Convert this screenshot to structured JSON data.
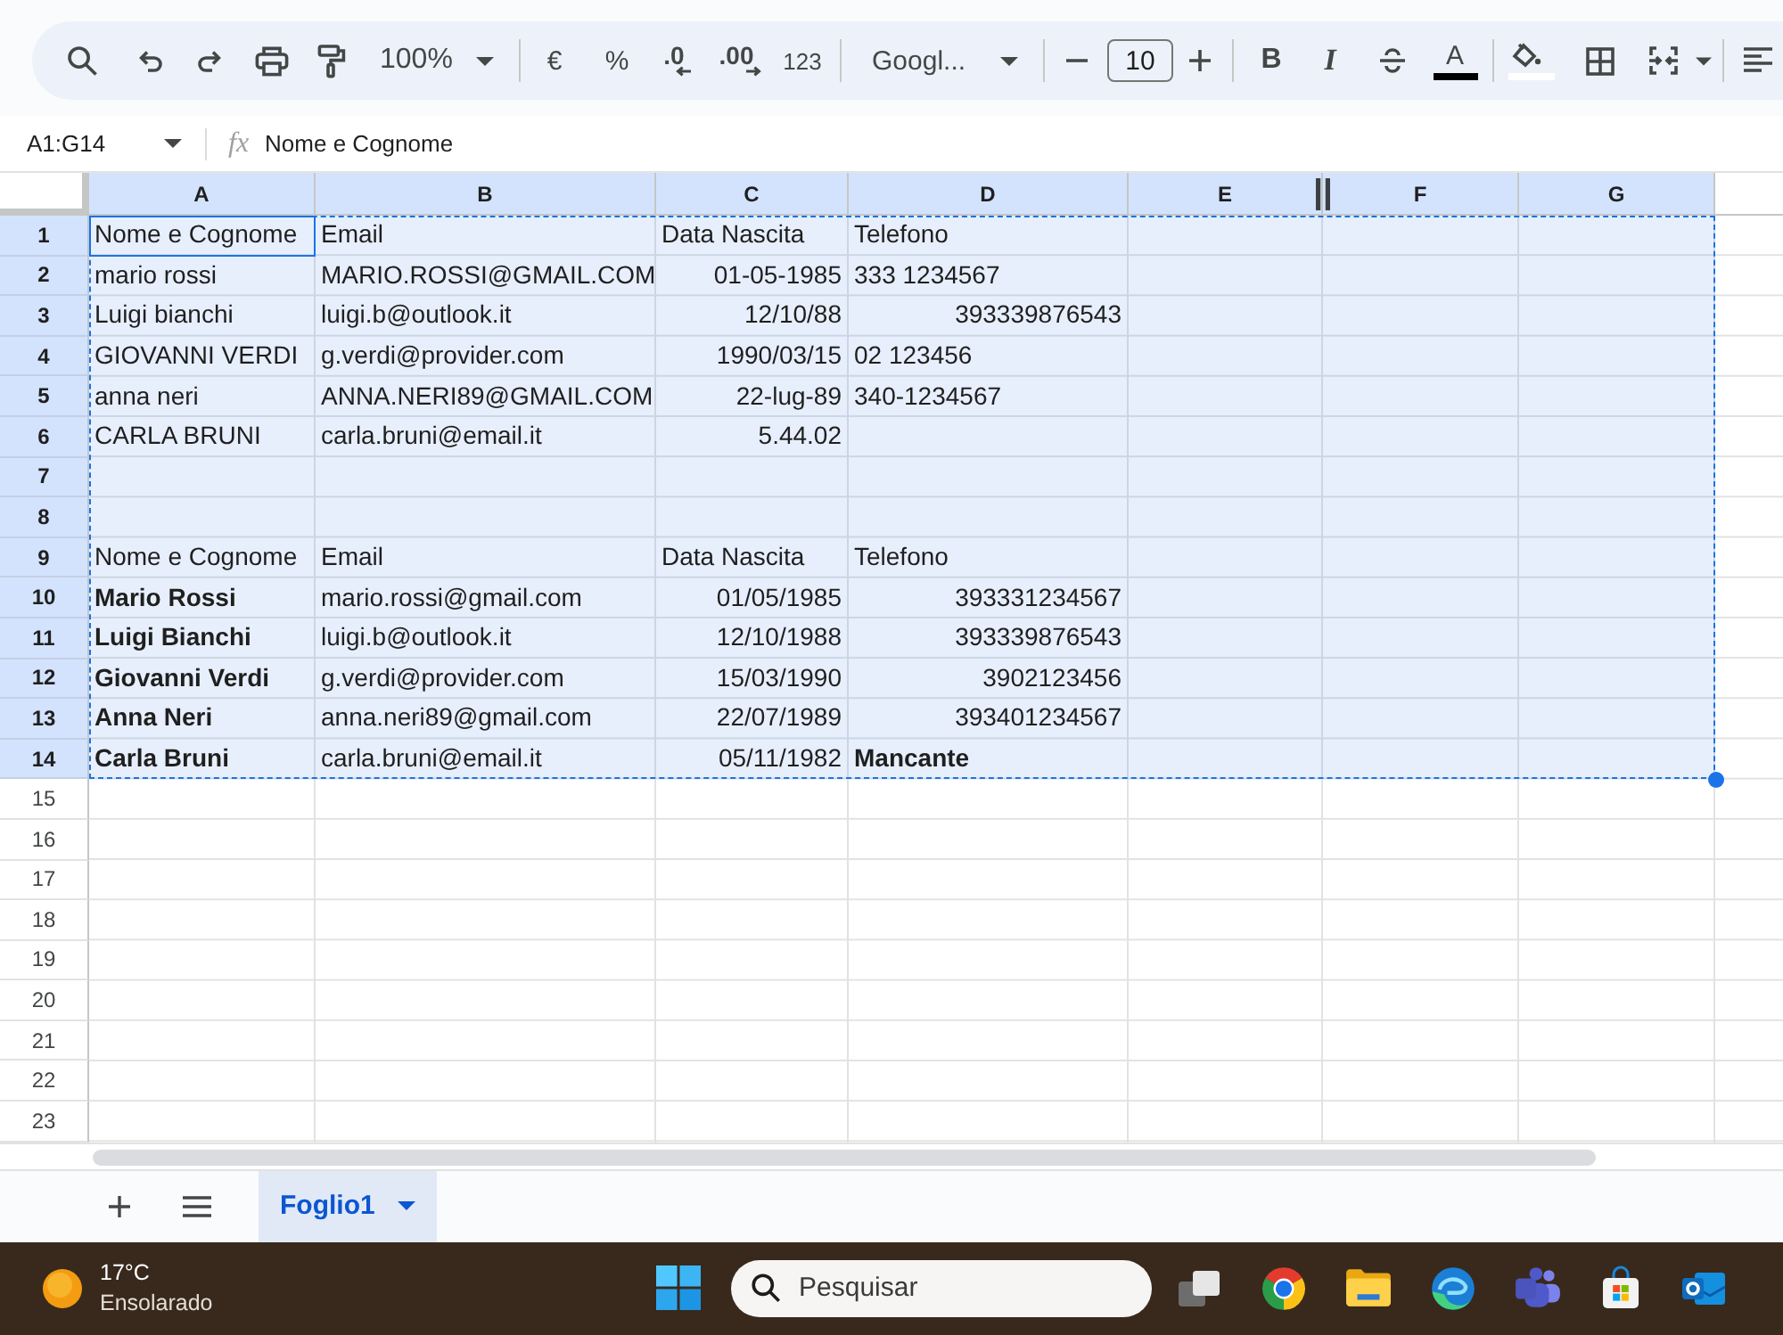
{
  "toolbar": {
    "zoom": "100%",
    "currency": "€",
    "percent": "%",
    "decrease_decimals": ".0",
    "increase_decimals": ".00",
    "number_format": "123",
    "font": "Googl...",
    "font_size": "10",
    "bold": "B",
    "italic": "I",
    "text_color": "A"
  },
  "formula_bar": {
    "name_box": "A1:G14",
    "function_label": "fx",
    "content": "Nome e Cognome"
  },
  "grid": {
    "selection_marquee": true,
    "columns": [
      {
        "label": "A",
        "selected": true
      },
      {
        "label": "B",
        "selected": true
      },
      {
        "label": "C",
        "selected": true
      },
      {
        "label": "D",
        "selected": true
      },
      {
        "label": "E",
        "selected": true
      },
      {
        "label": "F",
        "selected": true
      },
      {
        "label": "G",
        "selected": true
      }
    ],
    "rows": [
      {
        "label": "1",
        "selected": true,
        "cells": [
          {
            "text": "Nome e Cognome",
            "right_aligned": false,
            "bold": false,
            "active": true
          },
          {
            "text": "Email",
            "right_aligned": false,
            "bold": false,
            "active": false
          },
          {
            "text": "Data Nascita",
            "right_aligned": false,
            "bold": false,
            "active": false
          },
          {
            "text": "Telefono",
            "right_aligned": false,
            "bold": false,
            "active": false
          }
        ]
      },
      {
        "label": "2",
        "selected": true,
        "cells": [
          {
            "text": "mario rossi",
            "right_aligned": false,
            "bold": false,
            "active": false
          },
          {
            "text": "MARIO.ROSSI@GMAIL.COM",
            "right_aligned": false,
            "bold": false,
            "active": false
          },
          {
            "text": "01-05-1985",
            "right_aligned": true,
            "bold": false,
            "active": false
          },
          {
            "text": "333 1234567",
            "right_aligned": false,
            "bold": false,
            "active": false
          }
        ]
      },
      {
        "label": "3",
        "selected": true,
        "cells": [
          {
            "text": "Luigi bianchi",
            "right_aligned": false,
            "bold": false,
            "active": false
          },
          {
            "text": "luigi.b@outlook.it",
            "right_aligned": false,
            "bold": false,
            "active": false
          },
          {
            "text": "12/10/88",
            "right_aligned": true,
            "bold": false,
            "active": false
          },
          {
            "text": "393339876543",
            "right_aligned": true,
            "bold": false,
            "active": false
          }
        ]
      },
      {
        "label": "4",
        "selected": true,
        "cells": [
          {
            "text": "GIOVANNI VERDI",
            "right_aligned": false,
            "bold": false,
            "active": false
          },
          {
            "text": "g.verdi@provider.com",
            "right_aligned": false,
            "bold": false,
            "active": false
          },
          {
            "text": "1990/03/15",
            "right_aligned": true,
            "bold": false,
            "active": false
          },
          {
            "text": "02 123456",
            "right_aligned": false,
            "bold": false,
            "active": false
          }
        ]
      },
      {
        "label": "5",
        "selected": true,
        "cells": [
          {
            "text": "anna neri",
            "right_aligned": false,
            "bold": false,
            "active": false
          },
          {
            "text": "ANNA.NERI89@GMAIL.COM",
            "right_aligned": false,
            "bold": false,
            "active": false
          },
          {
            "text": "22-lug-89",
            "right_aligned": true,
            "bold": false,
            "active": false
          },
          {
            "text": "340-1234567",
            "right_aligned": false,
            "bold": false,
            "active": false
          }
        ]
      },
      {
        "label": "6",
        "selected": true,
        "cells": [
          {
            "text": "CARLA BRUNI",
            "right_aligned": false,
            "bold": false,
            "active": false
          },
          {
            "text": "carla.bruni@email.it",
            "right_aligned": false,
            "bold": false,
            "active": false
          },
          {
            "text": "5.44.02",
            "right_aligned": true,
            "bold": false,
            "active": false
          }
        ]
      },
      {
        "label": "7",
        "selected": true
      },
      {
        "label": "8",
        "selected": true
      },
      {
        "label": "9",
        "selected": true,
        "cells": [
          {
            "text": "Nome e Cognome",
            "right_aligned": false,
            "bold": false,
            "active": false
          },
          {
            "text": "Email",
            "right_aligned": false,
            "bold": false,
            "active": false
          },
          {
            "text": "Data Nascita",
            "right_aligned": false,
            "bold": false,
            "active": false
          },
          {
            "text": "Telefono",
            "right_aligned": false,
            "bold": false,
            "active": false
          }
        ]
      },
      {
        "label": "10",
        "selected": true,
        "cells": [
          {
            "text": "Mario Rossi",
            "right_aligned": false,
            "bold": true,
            "active": false
          },
          {
            "text": "mario.rossi@gmail.com",
            "right_aligned": false,
            "bold": false,
            "active": false
          },
          {
            "text": "01/05/1985",
            "right_aligned": true,
            "bold": false,
            "active": false
          },
          {
            "text": "393331234567",
            "right_aligned": true,
            "bold": false,
            "active": false
          }
        ]
      },
      {
        "label": "11",
        "selected": true,
        "cells": [
          {
            "text": "Luigi Bianchi",
            "right_aligned": false,
            "bold": true,
            "active": false
          },
          {
            "text": "luigi.b@outlook.it",
            "right_aligned": false,
            "bold": false,
            "active": false
          },
          {
            "text": "12/10/1988",
            "right_aligned": true,
            "bold": false,
            "active": false
          },
          {
            "text": "393339876543",
            "right_aligned": true,
            "bold": false,
            "active": false
          }
        ]
      },
      {
        "label": "12",
        "selected": true,
        "cells": [
          {
            "text": "Giovanni Verdi",
            "right_aligned": false,
            "bold": true,
            "active": false
          },
          {
            "text": "g.verdi@provider.com",
            "right_aligned": false,
            "bold": false,
            "active": false
          },
          {
            "text": "15/03/1990",
            "right_aligned": true,
            "bold": false,
            "active": false
          },
          {
            "text": "3902123456",
            "right_aligned": true,
            "bold": false,
            "active": false
          }
        ]
      },
      {
        "label": "13",
        "selected": true,
        "cells": [
          {
            "text": "Anna Neri",
            "right_aligned": false,
            "bold": true,
            "active": false
          },
          {
            "text": "anna.neri89@gmail.com",
            "right_aligned": false,
            "bold": false,
            "active": false
          },
          {
            "text": "22/07/1989",
            "right_aligned": true,
            "bold": false,
            "active": false
          },
          {
            "text": "393401234567",
            "right_aligned": true,
            "bold": false,
            "active": false
          }
        ]
      },
      {
        "label": "14",
        "selected": true,
        "cells": [
          {
            "text": "Carla Bruni",
            "right_aligned": false,
            "bold": true,
            "active": false
          },
          {
            "text": "carla.bruni@email.it",
            "right_aligned": false,
            "bold": false,
            "active": false
          },
          {
            "text": "05/11/1982",
            "right_aligned": true,
            "bold": false,
            "active": false
          },
          {
            "text": "Mancante",
            "right_aligned": false,
            "bold": true,
            "active": false
          }
        ]
      },
      {
        "label": "15",
        "selected": false
      },
      {
        "label": "16",
        "selected": false
      },
      {
        "label": "17",
        "selected": false
      },
      {
        "label": "18",
        "selected": false
      },
      {
        "label": "19",
        "selected": false
      },
      {
        "label": "20",
        "selected": false
      },
      {
        "label": "21",
        "selected": false
      },
      {
        "label": "22",
        "selected": false
      },
      {
        "label": "23",
        "selected": false
      }
    ]
  },
  "sheet_tabs": [
    {
      "label": "Foglio1",
      "selected": true
    }
  ],
  "taskbar": {
    "weather": {
      "temperature": "17°C",
      "condition": "Ensolarado"
    },
    "search": {
      "placeholder": "Pesquisar"
    }
  }
}
